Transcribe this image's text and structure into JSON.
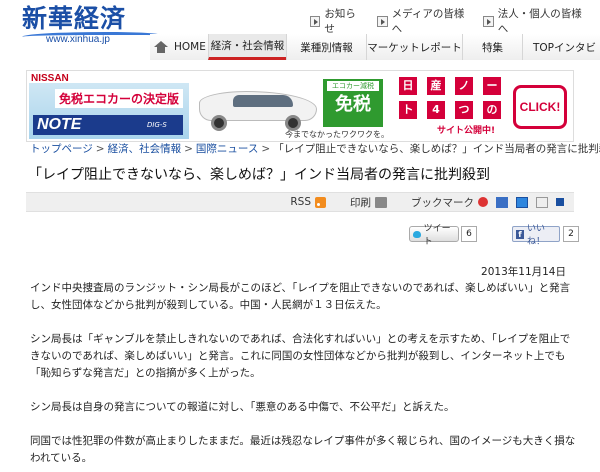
{
  "site": {
    "logo_main": "新華経済",
    "logo_url": "www.xinhua.jp"
  },
  "toplinks": [
    {
      "label": "お知らせ"
    },
    {
      "label": "メディアの皆様へ"
    },
    {
      "label": "法人・個人の皆様へ"
    }
  ],
  "nav": [
    {
      "label": "HOME"
    },
    {
      "label": "経済・社会情報"
    },
    {
      "label": "業種別情報"
    },
    {
      "label": "マーケットレポート"
    },
    {
      "label": "特集"
    },
    {
      "label": "TOPインタビ"
    }
  ],
  "banner": {
    "brand": "NISSAN",
    "headline": "免税エコカーの決定版",
    "model": "NOTE",
    "engine": "DIG-S",
    "eco_label": "エコカー減税",
    "eco_main": "免税",
    "catch": "今までなかったワクワクを。",
    "grid": [
      "日",
      "産",
      "ノ",
      "ー",
      "ト",
      "4",
      "つ",
      "の"
    ],
    "site_open": "サイト公開中!",
    "click": "CLICK!"
  },
  "breadcrumb": {
    "items": [
      "トップページ",
      "経済、社会情報",
      "国際ニュース"
    ],
    "current": "「レイプ阻止できないなら、楽しめば？」インド当局者の発言に批判殺到"
  },
  "article": {
    "title": "「レイプ阻止できないなら、楽しめば？」インド当局者の発言に批判殺到",
    "date": "2013年11月14日",
    "paragraphs": [
      "インド中央捜査局のランジット・シン局長がこのほど、「レイプを阻止できないのであれば、楽しめばいい」と発言し、女性団体などから批判が殺到している。中国・人民網が１３日伝えた。",
      "シン局長は「ギャンブルを禁止しきれないのであれば、合法化すればいい」との考えを示すため、「レイプを阻止できないのであれば、楽しめばいい」と発言。これに同国の女性団体などから批判が殺到し、インターネット上でも「恥知らずな発言だ」との指摘が多く上がった。",
      "シン局長は自身の発言についての報道に対し、「悪意のある中傷で、不公平だ」と訴えた。",
      "同国では性犯罪の件数が高止まりしたままだ。最近は残忍なレイプ事件が多く報じられ、国のイメージも大きく損なわれている。"
    ]
  },
  "toolbar": {
    "rss": "RSS",
    "print": "印刷",
    "bookmark": "ブックマーク"
  },
  "social": {
    "tweet": "ツイート",
    "tweet_count": "6",
    "like": "いいね！",
    "like_count": "2"
  }
}
